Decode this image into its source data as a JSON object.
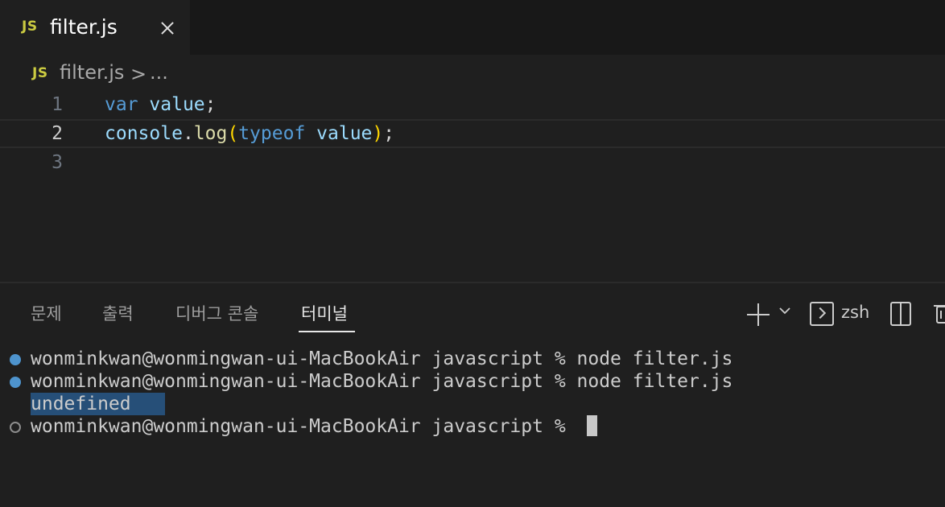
{
  "tab": {
    "badge": "JS",
    "label": "filter.js"
  },
  "breadcrumb": {
    "badge": "JS",
    "file": "filter.js",
    "separator": ">",
    "more": "..."
  },
  "editor": {
    "lines": [
      {
        "number": "1",
        "tokens": [
          "var",
          " ",
          "value",
          ";"
        ]
      },
      {
        "number": "2",
        "tokens": [
          "console",
          ".",
          "log",
          "(",
          "typeof",
          " ",
          "value",
          ")",
          ";"
        ]
      },
      {
        "number": "3",
        "tokens": []
      }
    ]
  },
  "panel": {
    "tabs": [
      "문제",
      "출력",
      "디버그 콘솔",
      "터미널"
    ],
    "active_tab": "터미널",
    "shell": "zsh"
  },
  "terminal": {
    "lines": [
      {
        "status": "done",
        "text": "wonminkwan@wonmingwan-ui-MacBookAir javascript % node filter.js"
      },
      {
        "status": "done",
        "text": "wonminkwan@wonmingwan-ui-MacBookAir javascript % node filter.js"
      },
      {
        "status": "output",
        "text": "undefined"
      },
      {
        "status": "pending",
        "text": "wonminkwan@wonmingwan-ui-MacBookAir javascript % "
      }
    ]
  },
  "colors": {
    "keyword": "#569cd6",
    "variable": "#9cdcfe",
    "function": "#dcdcaa",
    "bracket": "#ffd700",
    "selection": "#264f78",
    "js_badge": "#cbcb41"
  }
}
